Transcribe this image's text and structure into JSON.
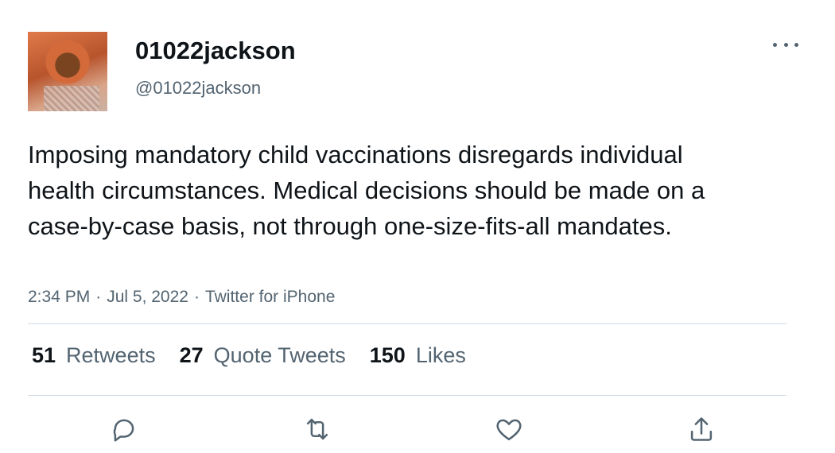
{
  "author": {
    "display_name": "01022jackson",
    "handle": "@01022jackson"
  },
  "tweet": {
    "text": "Imposing mandatory child vaccinations disregards individual health circumstances. Medical decisions should be made on a case-by-case basis, not through one-size-fits-all mandates.",
    "time": "2:34 PM",
    "date": "Jul 5, 2022",
    "source": "Twitter for iPhone",
    "separator": "·"
  },
  "stats": {
    "retweets_count": "51",
    "retweets_label": "Retweets",
    "quote_count": "27",
    "quote_label": "Quote Tweets",
    "likes_count": "150",
    "likes_label": "Likes"
  },
  "icons": {
    "more": "more-dots-icon",
    "reply": "reply-icon",
    "retweet": "retweet-icon",
    "like": "heart-icon",
    "share": "share-icon"
  },
  "colors": {
    "primary_text": "#0f1419",
    "secondary_text": "#536471",
    "divider": "#cfd9de"
  }
}
